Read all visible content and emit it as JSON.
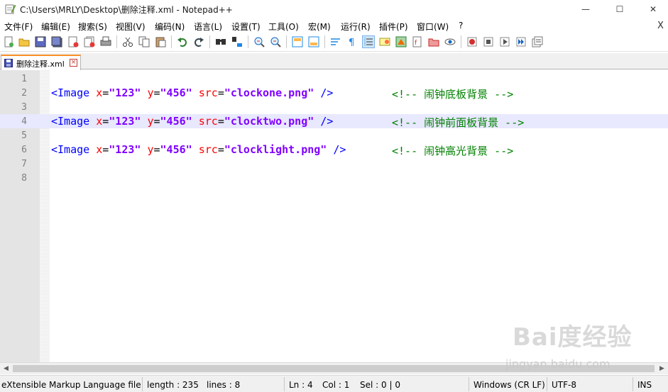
{
  "window": {
    "title": "C:\\Users\\MRLY\\Desktop\\删除注释.xml - Notepad++",
    "minimize_glyph": "—",
    "maximize_glyph": "☐",
    "close_glyph": "✕"
  },
  "menu": {
    "items": [
      "文件(F)",
      "编辑(E)",
      "搜索(S)",
      "视图(V)",
      "编码(N)",
      "语言(L)",
      "设置(T)",
      "工具(O)",
      "宏(M)",
      "运行(R)",
      "插件(P)",
      "窗口(W)",
      "?"
    ],
    "close_doc": "X"
  },
  "toolbar": {
    "icons": [
      "new-file-icon",
      "open-file-icon",
      "save-icon",
      "save-all-icon",
      "close-icon",
      "close-all-icon",
      "print-icon",
      "cut-icon",
      "copy-icon",
      "paste-icon",
      "undo-icon",
      "redo-icon",
      "find-icon",
      "replace-icon",
      "zoom-in-icon",
      "zoom-out-icon",
      "sync-vertical-icon",
      "sync-horizontal-icon",
      "word-wrap-icon",
      "show-all-chars-icon",
      "indent-guide-icon",
      "udl-icon",
      "doc-map-icon",
      "function-list-icon",
      "folder-as-workspace-icon",
      "monitoring-icon",
      "record-macro-icon",
      "stop-record-icon",
      "play-macro-icon",
      "run-macro-multiple-icon",
      "save-macro-icon"
    ]
  },
  "tab": {
    "label": "删除注释.xml",
    "close_glyph": "×"
  },
  "editor": {
    "lines": [
      {
        "num": "1",
        "tag_open": "",
        "x_attr": "",
        "x_val": "",
        "y_attr": "",
        "y_val": "",
        "src_attr": "",
        "src_val": "",
        "tag_close": "",
        "comment": ""
      },
      {
        "num": "2",
        "tag_open": "<Image",
        "x_attr": "x",
        "x_val": "\"123\"",
        "y_attr": "y",
        "y_val": "\"456\"",
        "src_attr": "src",
        "src_val": "\"clockone.png\"",
        "tag_close": "/>",
        "comment": "<!-- 闹钟底板背景 -->"
      },
      {
        "num": "3",
        "tag_open": "",
        "x_attr": "",
        "x_val": "",
        "y_attr": "",
        "y_val": "",
        "src_attr": "",
        "src_val": "",
        "tag_close": "",
        "comment": ""
      },
      {
        "num": "4",
        "tag_open": "<Image",
        "x_attr": "x",
        "x_val": "\"123\"",
        "y_attr": "y",
        "y_val": "\"456\"",
        "src_attr": "src",
        "src_val": "\"clocktwo.png\"",
        "tag_close": "/>",
        "comment": "<!-- 闹钟前面板背景 -->"
      },
      {
        "num": "5",
        "tag_open": "",
        "x_attr": "",
        "x_val": "",
        "y_attr": "",
        "y_val": "",
        "src_attr": "",
        "src_val": "",
        "tag_close": "",
        "comment": ""
      },
      {
        "num": "6",
        "tag_open": "<Image",
        "x_attr": "x",
        "x_val": "\"123\"",
        "y_attr": "y",
        "y_val": "\"456\"",
        "src_attr": "src",
        "src_val": "\"clocklight.png\"",
        "tag_close": "/>",
        "comment": "<!-- 闹钟高光背景 -->"
      },
      {
        "num": "7",
        "tag_open": "",
        "x_attr": "",
        "x_val": "",
        "y_attr": "",
        "y_val": "",
        "src_attr": "",
        "src_val": "",
        "tag_close": "",
        "comment": ""
      },
      {
        "num": "8",
        "tag_open": "",
        "x_attr": "",
        "x_val": "",
        "y_attr": "",
        "y_val": "",
        "src_attr": "",
        "src_val": "",
        "tag_close": "",
        "comment": ""
      }
    ],
    "active_line": "4"
  },
  "scrollbar": {
    "left_glyph": "◀",
    "right_glyph": "▶"
  },
  "status": {
    "language": "eXtensible Markup Language file",
    "length": "length : 235",
    "lines": "lines : 8",
    "ln": "Ln : 4",
    "col": "Col : 1",
    "sel": "Sel : 0 | 0",
    "eol": "Windows (CR LF)",
    "encoding": "UTF-8",
    "mode": "INS"
  },
  "watermark": {
    "brand": "Bai度经验",
    "url": "jingyan.baidu.com"
  },
  "colors": {
    "tag": "#0000ff",
    "attribute": "#ff0000",
    "value": "#8000ff",
    "comment": "#008000",
    "active_line": "#e8e8ff",
    "tab_accent": "#fa8f29"
  }
}
